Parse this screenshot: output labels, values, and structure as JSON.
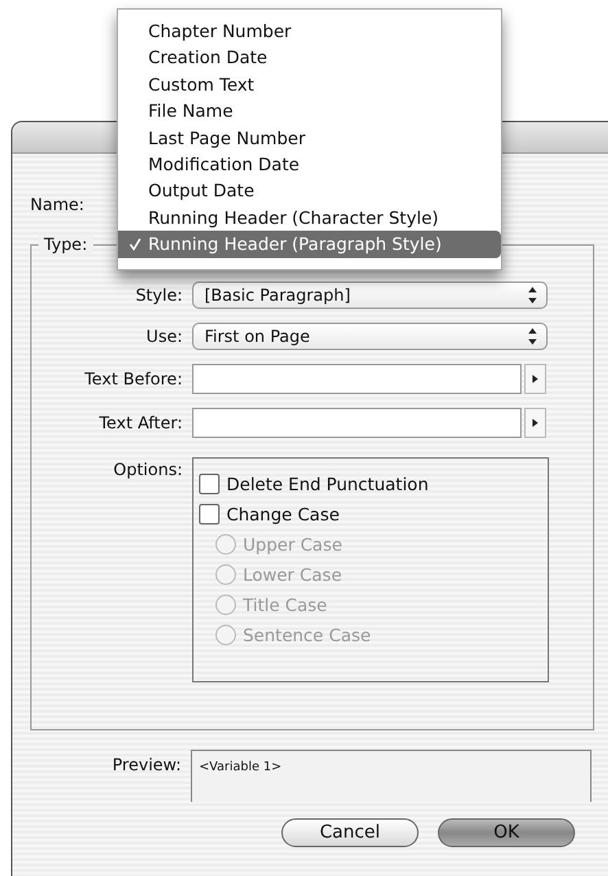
{
  "menu": {
    "items": [
      {
        "label": "Chapter Number",
        "selected": false
      },
      {
        "label": "Creation Date",
        "selected": false
      },
      {
        "label": "Custom Text",
        "selected": false
      },
      {
        "label": "File Name",
        "selected": false
      },
      {
        "label": "Last Page Number",
        "selected": false
      },
      {
        "label": "Modification Date",
        "selected": false
      },
      {
        "label": "Output Date",
        "selected": false
      },
      {
        "label": "Running Header (Character Style)",
        "selected": false
      },
      {
        "label": "Running Header (Paragraph Style)",
        "selected": true
      }
    ]
  },
  "dialog": {
    "name_label": "Name:",
    "type_label": "Type:",
    "selects": [
      {
        "label": "Style:",
        "value": "[Basic Paragraph]"
      },
      {
        "label": "Use:",
        "value": "First on Page"
      }
    ],
    "text_fields": [
      {
        "label": "Text Before:"
      },
      {
        "label": "Text After:"
      }
    ],
    "options": {
      "label": "Options:",
      "items": [
        {
          "kind": "checkbox",
          "label": "Delete End Punctuation",
          "checked": false,
          "disabled": false
        },
        {
          "kind": "checkbox",
          "label": "Change Case",
          "checked": false,
          "disabled": false
        },
        {
          "kind": "radio",
          "label": "Upper Case",
          "selected": false,
          "disabled": true
        },
        {
          "kind": "radio",
          "label": "Lower Case",
          "selected": false,
          "disabled": true
        },
        {
          "kind": "radio",
          "label": "Title Case",
          "selected": false,
          "disabled": true
        },
        {
          "kind": "radio",
          "label": "Sentence Case",
          "selected": false,
          "disabled": true
        }
      ]
    },
    "preview": {
      "label": "Preview:",
      "value": "<Variable 1>"
    },
    "buttons": [
      {
        "label": "Cancel",
        "default": false
      },
      {
        "label": "OK",
        "default": true
      }
    ]
  }
}
